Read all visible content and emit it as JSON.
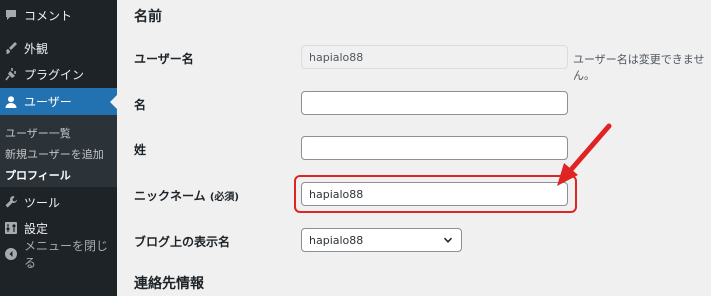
{
  "sidebar": {
    "comments": "コメント",
    "appearance": "外観",
    "plugins": "プラグイン",
    "users": "ユーザー",
    "submenu": {
      "list": "ユーザー一覧",
      "add_new": "新規ユーザーを追加",
      "profile": "プロフィール"
    },
    "tools": "ツール",
    "settings": "設定",
    "collapse": "メニューを閉じる"
  },
  "form": {
    "section_name": "名前",
    "section_contact": "連絡先情報",
    "username_label": "ユーザー名",
    "username_value": "hapialo88",
    "username_note": "ユーザー名は変更できません。",
    "first_name_label": "名",
    "first_name_value": "",
    "last_name_label": "姓",
    "last_name_value": "",
    "nickname_label": "ニックネーム",
    "nickname_required": "(必須)",
    "nickname_value": "hapialo88",
    "display_name_label": "ブログ上の表示名",
    "display_name_value": "hapialo88"
  },
  "colors": {
    "sidebar_bg": "#1d2327",
    "active_menu": "#2271b1",
    "highlight": "#e02424"
  }
}
